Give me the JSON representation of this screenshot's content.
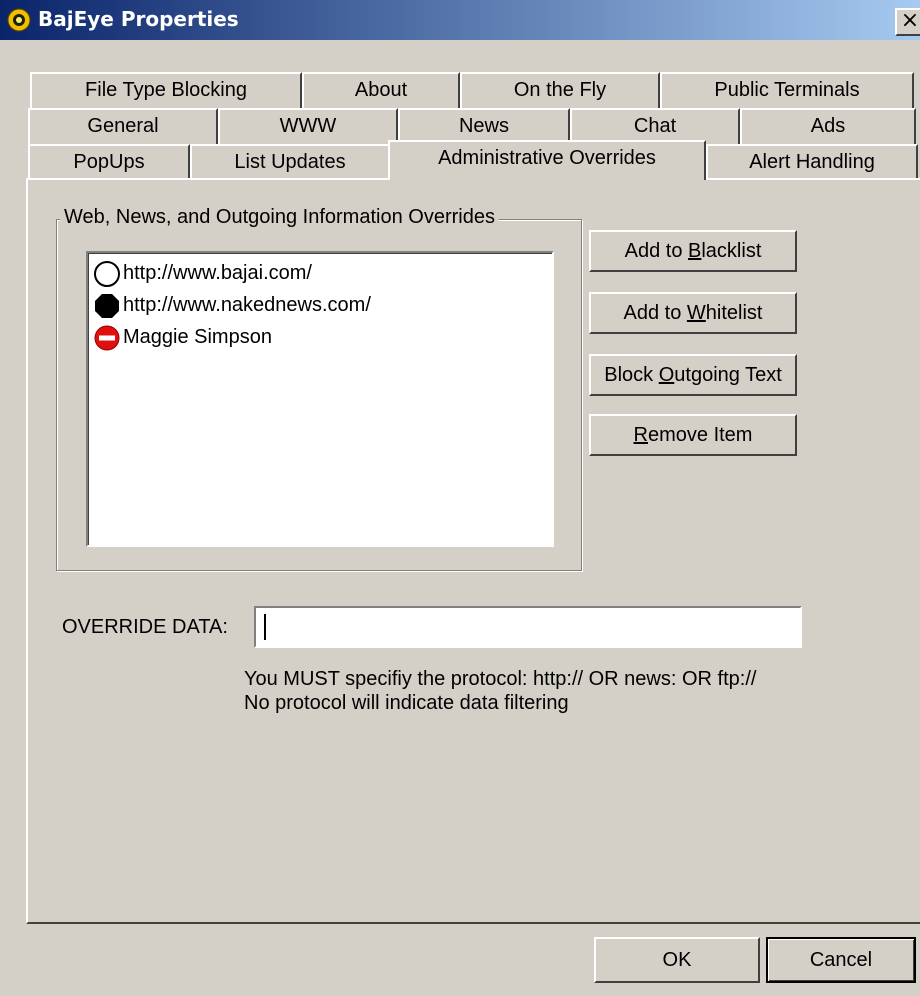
{
  "window": {
    "title": "BajEye Properties",
    "close_label": "×"
  },
  "tabs": {
    "row1": [
      "File Type Blocking",
      "About",
      "On the Fly",
      "Public Terminals"
    ],
    "row2": [
      "General",
      "WWW",
      "News",
      "Chat",
      "Ads"
    ],
    "row3": [
      "PopUps",
      "List Updates",
      "Administrative Overrides",
      "Alert Handling"
    ],
    "active": "Administrative Overrides"
  },
  "overrides": {
    "group_label": "Web, News, and Outgoing Information Overrides",
    "items": [
      {
        "icon": "white-circle-icon",
        "text": "http://www.bajai.com/"
      },
      {
        "icon": "black-octagon-icon",
        "text": "http://www.nakednews.com/"
      },
      {
        "icon": "no-entry-icon",
        "text": "Maggie Simpson"
      }
    ]
  },
  "buttons": {
    "add_blacklist": {
      "pre": "Add to ",
      "key": "B",
      "post": "lacklist"
    },
    "add_whitelist": {
      "pre": "Add to ",
      "key": "W",
      "post": "hitelist"
    },
    "block_outgoing": {
      "pre": "Block ",
      "key": "O",
      "post": "utgoing Text"
    },
    "remove_item": {
      "pre": "",
      "key": "R",
      "post": "emove Item"
    },
    "ok": "OK",
    "cancel": "Cancel"
  },
  "override_data": {
    "label": "OVERRIDE DATA:",
    "value": "",
    "hint_line1": "You MUST specifiy the protocol: http:// OR news: OR ftp://",
    "hint_line2": "No protocol will indicate data filtering"
  },
  "colors": {
    "titlebar_start": "#0a246a",
    "titlebar_end": "#a6caf0",
    "face": "#d4d0c8",
    "no_entry_red": "#e01010"
  }
}
